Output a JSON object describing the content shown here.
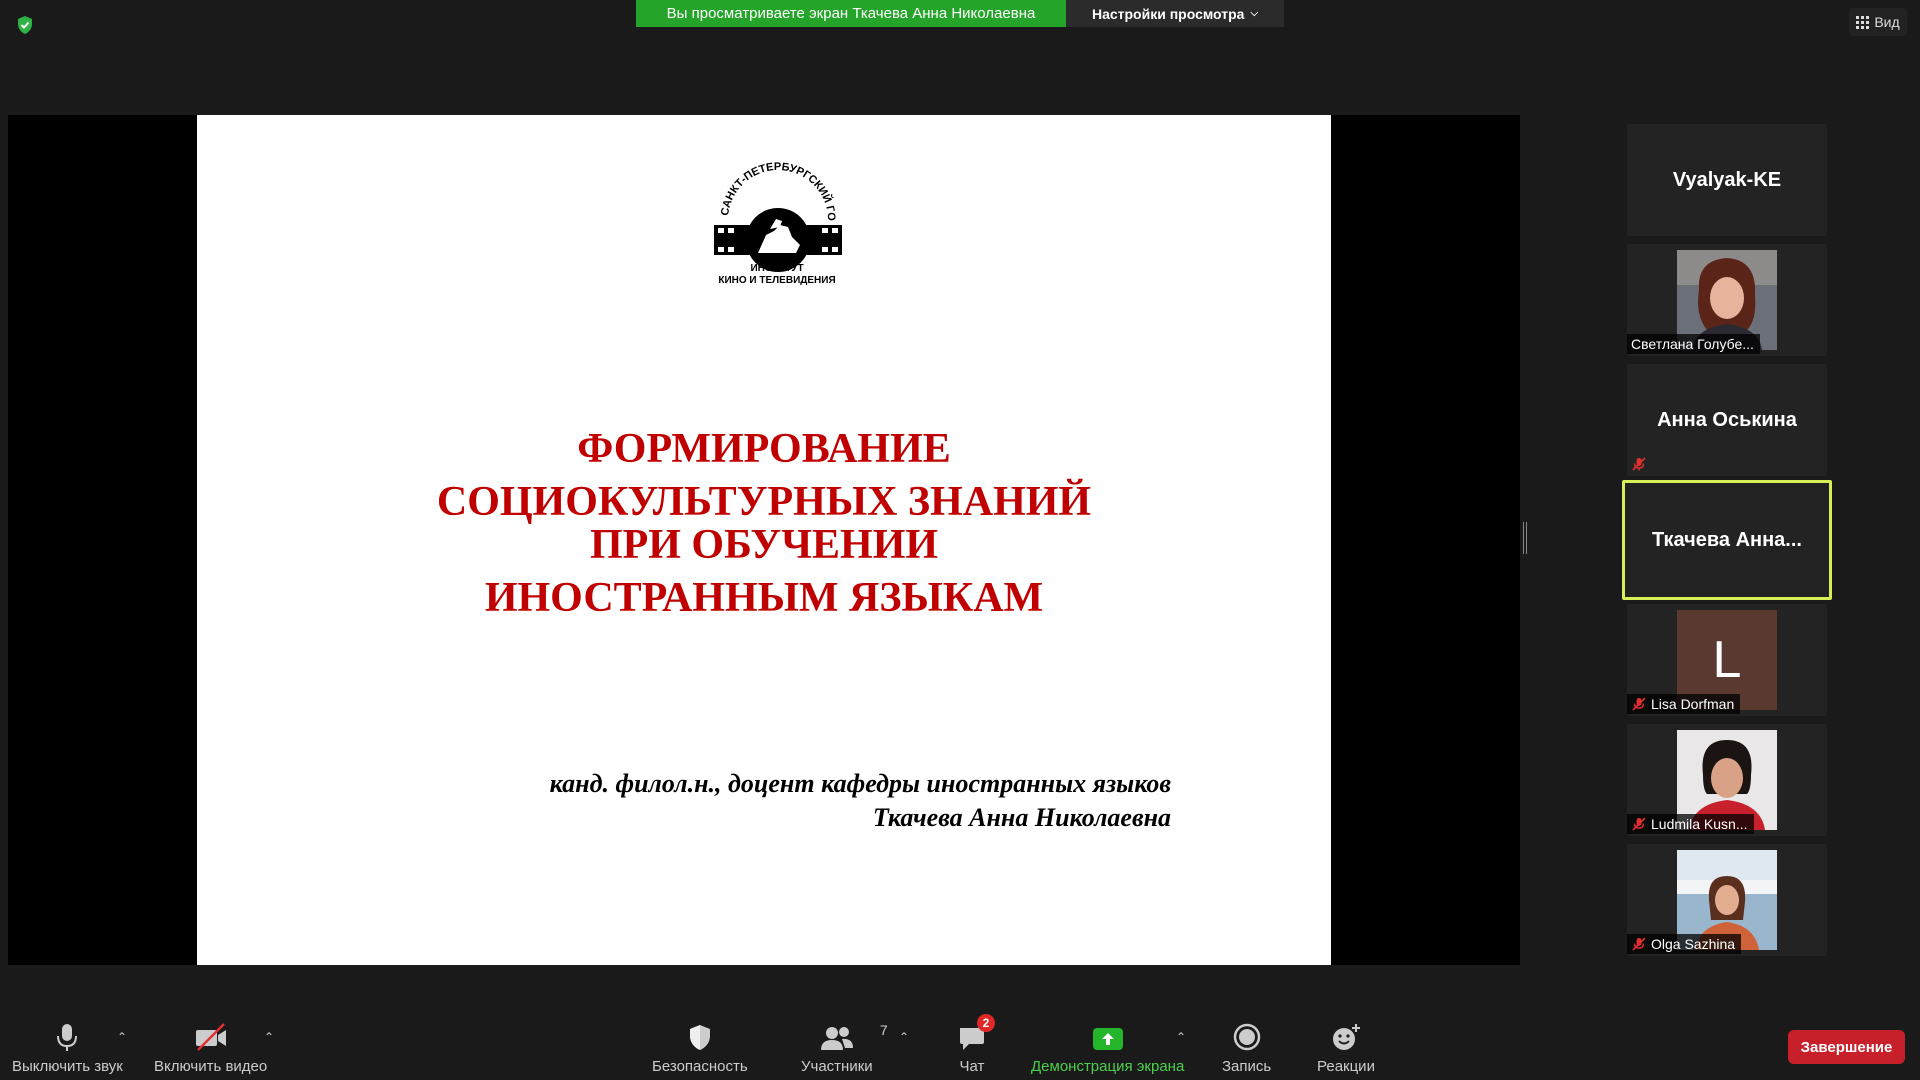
{
  "banner": {
    "text": "Вы просматриваете экран Ткачева Анна Николаевна"
  },
  "view_options": {
    "label": "Настройки просмотра"
  },
  "view_toggle": {
    "label": "Вид"
  },
  "slide": {
    "logo_arc": "САНКТ-ПЕТЕРБУРГСКИЙ ГОСУДАРСТВЕННЫЙ",
    "logo_line1": "ИНСТИТУТ",
    "logo_line2": "КИНО И ТЕЛЕВИДЕНИЯ",
    "title_lines": [
      "ФОРМИРОВАНИЕ",
      "СОЦИОКУЛЬТУРНЫХ ЗНАНИЙ",
      "ПРИ ОБУЧЕНИИ",
      "ИНОСТРАННЫМ ЯЗЫКАМ"
    ],
    "author_line1": "канд. филол.н., доцент кафедры иностранных языков",
    "author_line2": "Ткачева Анна Николаевна"
  },
  "participants": [
    {
      "name": "Vyalyak-KE",
      "kind": "name"
    },
    {
      "name": "Светлана Голубе...",
      "kind": "photo",
      "muted": false
    },
    {
      "name": "Анна Оськина",
      "kind": "name",
      "muted": true
    },
    {
      "name": "Ткачева  Анна...",
      "kind": "name",
      "active": true
    },
    {
      "name": "Lisa Dorfman",
      "kind": "letter",
      "letter": "L",
      "muted": true
    },
    {
      "name": "Ludmila Kusn...",
      "kind": "photo",
      "muted": true
    },
    {
      "name": "Olga Sazhina",
      "kind": "photo",
      "muted": true
    }
  ],
  "toolbar": {
    "mute": "Выключить звук",
    "video": "Включить видео",
    "security": "Безопасность",
    "participants": "Участники",
    "participants_count": "7",
    "chat": "Чат",
    "chat_badge": "2",
    "share": "Демонстрация экрана",
    "record": "Запись",
    "reactions": "Реакции",
    "end": "Завершение"
  },
  "colors": {
    "share_green": "#24a52a",
    "active_border": "#d8f056",
    "end_red": "#c8202a",
    "title_red": "#c00000"
  },
  "icons": [
    "shield-check-icon",
    "chevron-down-icon",
    "grid-icon",
    "mic-icon",
    "video-off-icon",
    "shield-icon",
    "people-icon",
    "chat-icon",
    "share-screen-icon",
    "record-icon",
    "reaction-icon",
    "mic-muted-icon"
  ]
}
